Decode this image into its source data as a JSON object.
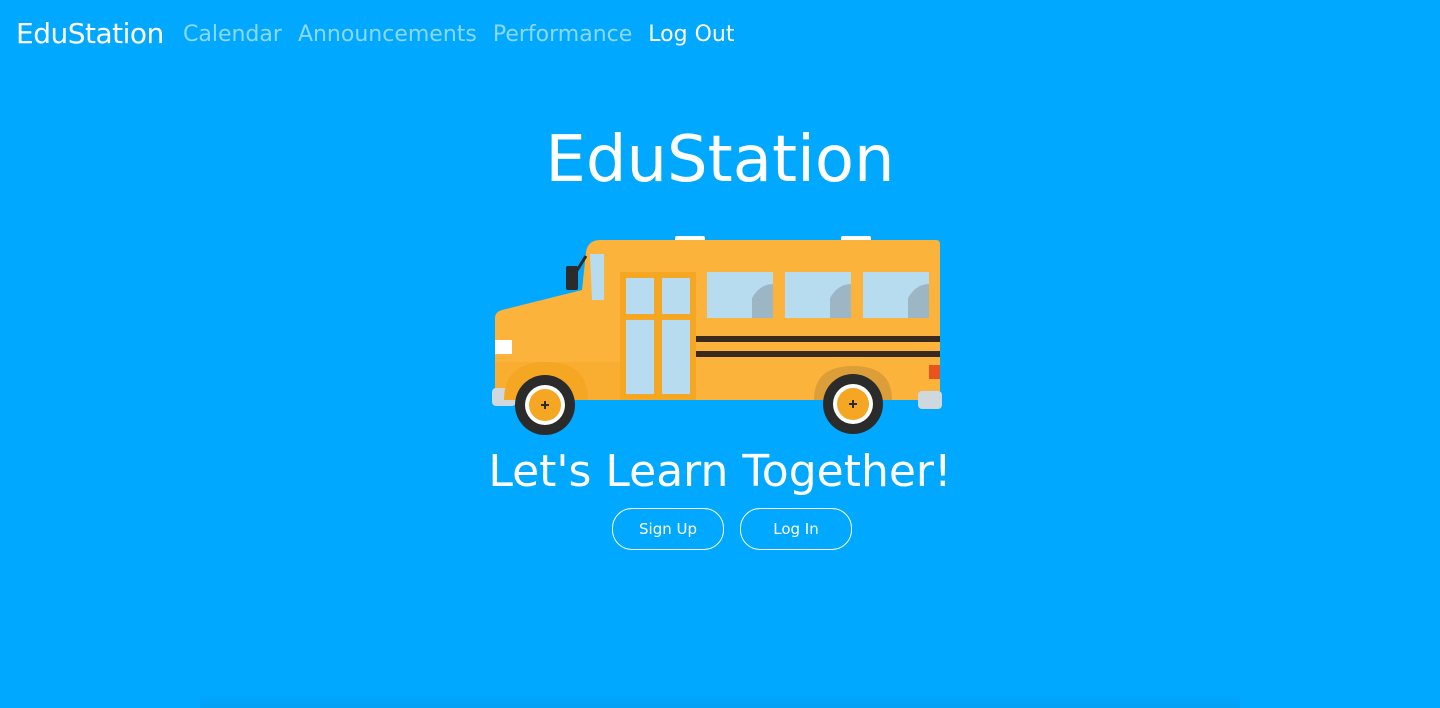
{
  "nav": {
    "brand": "EduStation",
    "links": [
      {
        "label": "Calendar"
      },
      {
        "label": "Announcements"
      },
      {
        "label": "Performance"
      },
      {
        "label": "Log Out"
      }
    ]
  },
  "hero": {
    "title": "EduStation",
    "image_icon": "school-bus-illustration",
    "tagline": "Let's Learn Together!",
    "buttons": {
      "signup": "Sign Up",
      "login": "Log In"
    }
  },
  "colors": {
    "background": "#00a8ff",
    "text": "#ffffff",
    "bus_body": "#fbb33b"
  }
}
